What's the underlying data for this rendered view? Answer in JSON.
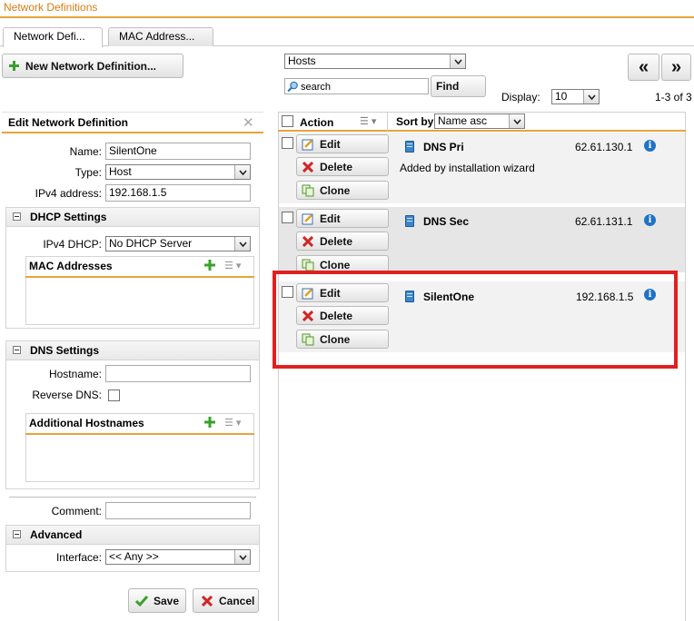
{
  "window": {
    "title": "Network Definitions"
  },
  "tabs": [
    {
      "label": "Network Defi..."
    },
    {
      "label": "MAC Address..."
    }
  ],
  "toolbar": {
    "new_button": "New Network Definition...",
    "filter_type": "Hosts",
    "search_placeholder": "search",
    "find_button": "Find",
    "display_label": "Display:",
    "display_value": "10",
    "range_text": "1-3 of 3",
    "prev_glyph": "«",
    "next_glyph": "»"
  },
  "edit_panel": {
    "title": "Edit Network Definition",
    "name_label": "Name:",
    "name_value": "SilentOne",
    "type_label": "Type:",
    "type_value": "Host",
    "ipv4_label": "IPv4 address:",
    "ipv4_value": "192.168.1.5",
    "dhcp": {
      "title": "DHCP Settings",
      "ipv4_dhcp_label": "IPv4 DHCP:",
      "ipv4_dhcp_value": "No DHCP Server",
      "mac_title": "MAC Addresses"
    },
    "dns": {
      "title": "DNS Settings",
      "hostname_label": "Hostname:",
      "hostname_value": "",
      "reverse_dns_label": "Reverse DNS:",
      "additional_title": "Additional Hostnames"
    },
    "comment_label": "Comment:",
    "comment_value": "",
    "advanced": {
      "title": "Advanced",
      "interface_label": "Interface:",
      "interface_value": "<< Any >>"
    },
    "save_button": "Save",
    "cancel_button": "Cancel"
  },
  "list": {
    "action_header": "Action",
    "sort_label": "Sort by:",
    "sort_value": "Name asc",
    "row_actions": {
      "edit": "Edit",
      "delete": "Delete",
      "clone": "Clone"
    },
    "rows": [
      {
        "name": "DNS Pri",
        "address": "62.61.130.1",
        "comment": "Added by installation wizard"
      },
      {
        "name": "DNS Sec",
        "address": "62.61.131.1",
        "comment": ""
      },
      {
        "name": "SilentOne",
        "address": "192.168.1.5",
        "comment": ""
      }
    ]
  },
  "colors": {
    "accent_orange": "#e8a33c",
    "title_orange": "#d87c14",
    "highlight_red": "#e02020",
    "info_blue": "#1e73c9",
    "plus_green": "#3aa02c",
    "delete_red": "#d02626"
  }
}
